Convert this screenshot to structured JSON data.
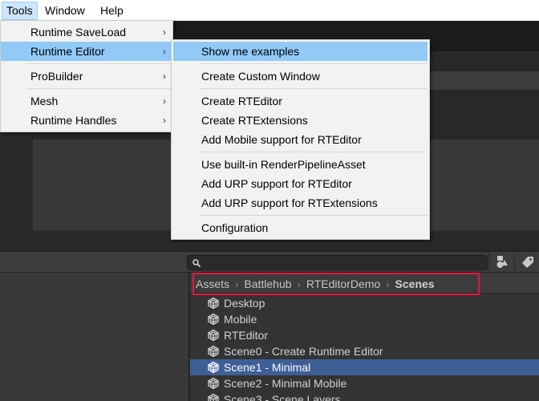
{
  "menubar": {
    "items": [
      {
        "label": "Tools",
        "active": true
      },
      {
        "label": "Window",
        "active": false
      },
      {
        "label": "Help",
        "active": false
      }
    ]
  },
  "tools_menu": {
    "items": [
      {
        "label": "Runtime SaveLoad",
        "submenu": true,
        "highlighted": false
      },
      {
        "label": "Runtime Editor",
        "submenu": true,
        "highlighted": true
      },
      {
        "separator": true
      },
      {
        "label": "ProBuilder",
        "submenu": true,
        "highlighted": false
      },
      {
        "separator": true
      },
      {
        "label": "Mesh",
        "submenu": true,
        "highlighted": false
      },
      {
        "label": "Runtime Handles",
        "submenu": true,
        "highlighted": false
      }
    ],
    "arrow_glyph": "›"
  },
  "runtime_editor_submenu": {
    "items": [
      {
        "label": "Show me examples",
        "highlighted": true
      },
      {
        "separator": true
      },
      {
        "label": "Create Custom Window"
      },
      {
        "separator": true
      },
      {
        "label": "Create RTEditor"
      },
      {
        "label": "Create RTExtensions"
      },
      {
        "label": "Add Mobile support for RTEditor"
      },
      {
        "separator": true
      },
      {
        "label": "Use built-in RenderPipelineAsset"
      },
      {
        "label": "Add URP support for RTEditor"
      },
      {
        "label": "Add URP support for RTExtensions"
      },
      {
        "separator": true
      },
      {
        "label": "Configuration"
      }
    ]
  },
  "project": {
    "search": {
      "value": "",
      "placeholder": ""
    },
    "toolbar_icons": [
      "filter-by-type-icon",
      "filter-by-label-icon"
    ],
    "breadcrumb": {
      "items": [
        "Assets",
        "Battlehub",
        "RTEditorDemo",
        "Scenes"
      ],
      "separator": "›"
    },
    "files": [
      {
        "name": "Desktop",
        "selected": false
      },
      {
        "name": "Mobile",
        "selected": false
      },
      {
        "name": "RTEditor",
        "selected": false
      },
      {
        "name": "Scene0 - Create Runtime Editor",
        "selected": false
      },
      {
        "name": "Scene1 - Minimal",
        "selected": true
      },
      {
        "name": "Scene2 - Minimal Mobile",
        "selected": false
      },
      {
        "name": "Scene3 - Scene Layers",
        "selected": false
      }
    ]
  },
  "colors": {
    "menu_highlight": "#91c9f7",
    "selection": "#3e5f96",
    "breadcrumb_outline": "#e8173c"
  }
}
